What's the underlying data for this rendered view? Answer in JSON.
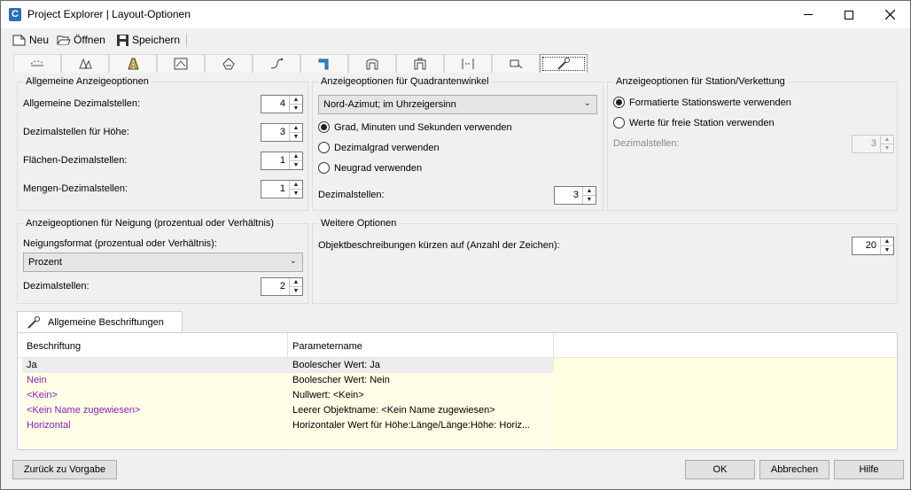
{
  "window": {
    "title": "Project Explorer | Layout-Optionen",
    "app_icon_letter": "C"
  },
  "toolbar": {
    "new_label": "Neu",
    "open_label": "Öffnen",
    "save_label": "Speichern"
  },
  "ribbon_tabs": [
    {
      "icon": "alignment-icon"
    },
    {
      "icon": "surface-icon"
    },
    {
      "icon": "road-icon"
    },
    {
      "icon": "profile-icon"
    },
    {
      "icon": "parcel-icon"
    },
    {
      "icon": "pipe-icon"
    },
    {
      "icon": "corridor-icon"
    },
    {
      "icon": "assembly-icon"
    },
    {
      "icon": "subassembly-icon"
    },
    {
      "icon": "section-icon"
    },
    {
      "icon": "sample-line-icon"
    },
    {
      "icon": "settings-wrench-icon",
      "active": true
    }
  ],
  "general": {
    "title": "Allgemeine Anzeigeoptionen",
    "rows": [
      {
        "label": "Allgemeine Dezimalstellen:",
        "value": "4"
      },
      {
        "label": "Dezimalstellen für Höhe:",
        "value": "3"
      },
      {
        "label": "Flächen-Dezimalstellen:",
        "value": "1"
      },
      {
        "label": "Mengen-Dezimalstellen:",
        "value": "1"
      }
    ]
  },
  "quadrant": {
    "title": "Anzeigeoptionen für Quadrantenwinkel",
    "combo_value": "Nord-Azimut; im Uhrzeigersinn",
    "options": [
      {
        "label": "Grad, Minuten und Sekunden verwenden",
        "checked": true
      },
      {
        "label": "Dezimalgrad verwenden",
        "checked": false
      },
      {
        "label": "Neugrad verwenden",
        "checked": false
      }
    ],
    "decimals_label": "Dezimalstellen:",
    "decimals_value": "3"
  },
  "station": {
    "title": "Anzeigeoptionen für Station/Verkettung",
    "options": [
      {
        "label": "Formatierte Stationswerte verwenden",
        "checked": true
      },
      {
        "label": "Werte für freie Station verwenden",
        "checked": false
      }
    ],
    "decimals_label": "Dezimalstellen:",
    "decimals_value": "3"
  },
  "slope": {
    "title": "Anzeigeoptionen für Neigung (prozentual oder Verhältnis)",
    "format_label": "Neigungsformat (prozentual oder Verhältnis):",
    "combo_value": "Prozent",
    "decimals_label": "Dezimalstellen:",
    "decimals_value": "2"
  },
  "further": {
    "title": "Weitere Optionen",
    "truncate_label": "Objektbeschreibungen kürzen auf (Anzahl der Zeichen):",
    "truncate_value": "20"
  },
  "labels": {
    "tab_label": "Allgemeine Beschriftungen",
    "columns": [
      "Beschriftung",
      "Parametername"
    ],
    "rows": [
      {
        "label": "Ja",
        "param": "Boolescher Wert: Ja",
        "color": "#000000"
      },
      {
        "label": "Nein",
        "param": "Boolescher Wert: Nein",
        "color": "#8b1db8"
      },
      {
        "label": "<Kein>",
        "param": "Nullwert: <Kein>",
        "color": "#8b1db8"
      },
      {
        "label": "<Kein Name zugewiesen>",
        "param": "Leerer Objektname: <Kein Name zugewiesen>",
        "color": "#8b1db8"
      },
      {
        "label": "Horizontal",
        "param": "Horizontaler Wert für Höhe:Länge/Länge:Höhe: Horiz...",
        "color": "#8b1db8"
      }
    ]
  },
  "buttons": {
    "reset": "Zurück zu Vorgabe",
    "ok": "OK",
    "cancel": "Abbrechen",
    "help": "Hilfe"
  }
}
